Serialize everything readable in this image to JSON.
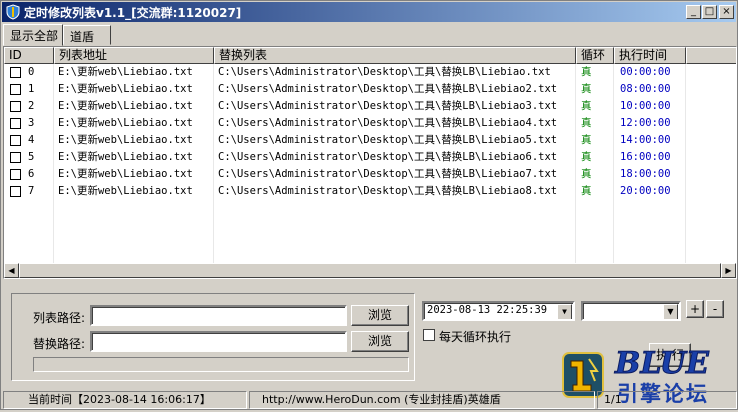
{
  "window": {
    "title": "定时修改列表v1.1_[交流群:1120027]",
    "controls": [
      "_",
      "□",
      "×"
    ]
  },
  "tabs": [
    {
      "label": "显示全部",
      "active": true
    },
    {
      "label": "道盾",
      "active": false
    }
  ],
  "list": {
    "columns": [
      "ID",
      "列表地址",
      "替换列表",
      "循环",
      "执行时间"
    ],
    "rows": [
      {
        "id": "0",
        "list_path": "E:\\更新web\\Liebiao.txt",
        "replace": "C:\\Users\\Administrator\\Desktop\\工具\\替换LB\\Liebiao.txt",
        "loop": "真",
        "time": "00:00:00"
      },
      {
        "id": "1",
        "list_path": "E:\\更新web\\Liebiao.txt",
        "replace": "C:\\Users\\Administrator\\Desktop\\工具\\替换LB\\Liebiao2.txt",
        "loop": "真",
        "time": "08:00:00"
      },
      {
        "id": "2",
        "list_path": "E:\\更新web\\Liebiao.txt",
        "replace": "C:\\Users\\Administrator\\Desktop\\工具\\替换LB\\Liebiao3.txt",
        "loop": "真",
        "time": "10:00:00"
      },
      {
        "id": "3",
        "list_path": "E:\\更新web\\Liebiao.txt",
        "replace": "C:\\Users\\Administrator\\Desktop\\工具\\替换LB\\Liebiao4.txt",
        "loop": "真",
        "time": "12:00:00"
      },
      {
        "id": "4",
        "list_path": "E:\\更新web\\Liebiao.txt",
        "replace": "C:\\Users\\Administrator\\Desktop\\工具\\替换LB\\Liebiao5.txt",
        "loop": "真",
        "time": "14:00:00"
      },
      {
        "id": "5",
        "list_path": "E:\\更新web\\Liebiao.txt",
        "replace": "C:\\Users\\Administrator\\Desktop\\工具\\替换LB\\Liebiao6.txt",
        "loop": "真",
        "time": "16:00:00"
      },
      {
        "id": "6",
        "list_path": "E:\\更新web\\Liebiao.txt",
        "replace": "C:\\Users\\Administrator\\Desktop\\工具\\替换LB\\Liebiao7.txt",
        "loop": "真",
        "time": "18:00:00"
      },
      {
        "id": "7",
        "list_path": "E:\\更新web\\Liebiao.txt",
        "replace": "C:\\Users\\Administrator\\Desktop\\工具\\替换LB\\Liebiao8.txt",
        "loop": "真",
        "time": "20:00:00"
      }
    ]
  },
  "form": {
    "list_path_label": "列表路径:",
    "replace_path_label": "替换路径:",
    "browse_label": "浏览",
    "datetime_value": "2023-08-13 22:25:39",
    "daily_loop_label": "每天循环执行",
    "plus_label": "+",
    "minus_label": "-",
    "exec_label": "执 行"
  },
  "status": {
    "current_time": "当前时间【2023-08-14 16:06:17】",
    "website": "http://www.HeroDun.com (专业封挂盾)英雄盾",
    "page": "1/1"
  },
  "logo": {
    "line1": "BLUE",
    "line2": "引擎论坛"
  },
  "colors": {
    "loop_true": "#008000",
    "time_text": "#0000c0",
    "title_start": "#0a246a",
    "title_end": "#a6caf0"
  },
  "icons": {
    "title": "shield-icon",
    "combo": "chevron-down-icon"
  }
}
